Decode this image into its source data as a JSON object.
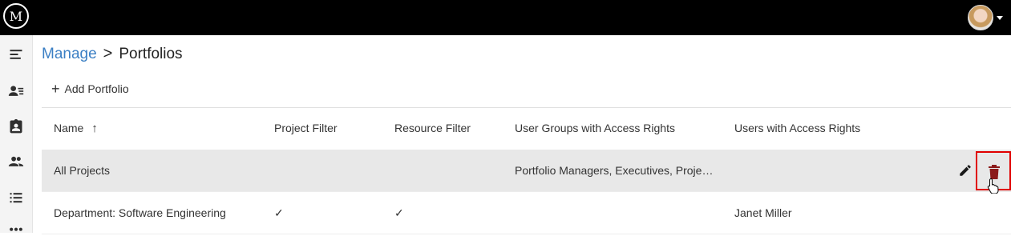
{
  "app": {
    "logo_text": "M"
  },
  "breadcrumb": {
    "parent": "Manage",
    "separator": ">",
    "current": "Portfolios"
  },
  "toolbar": {
    "add_label": "Add Portfolio"
  },
  "table": {
    "columns": [
      "Name",
      "Project Filter",
      "Resource Filter",
      "User Groups with Access Rights",
      "Users with Access Rights"
    ],
    "sort_indicator": "↑",
    "rows": [
      {
        "name": "All Projects",
        "project_filter": "",
        "resource_filter": "",
        "user_groups": "Portfolio Managers, Executives, Proje…",
        "users": ""
      },
      {
        "name": "Department: Software Engineering",
        "project_filter": "✓",
        "resource_filter": "✓",
        "user_groups": "",
        "users": "Janet Miller"
      }
    ]
  },
  "colors": {
    "accent": "#3b7fc4",
    "highlight_border": "#e00000",
    "delete_icon": "#8b1a1a",
    "topbar": "#000000"
  },
  "icons": {
    "sidebar": [
      "menu-collapse-icon",
      "person-list-icon",
      "assignment-ind-icon",
      "people-icon",
      "list-icon",
      "apps-icon"
    ],
    "row_actions": [
      "pencil-icon",
      "trash-icon"
    ]
  }
}
